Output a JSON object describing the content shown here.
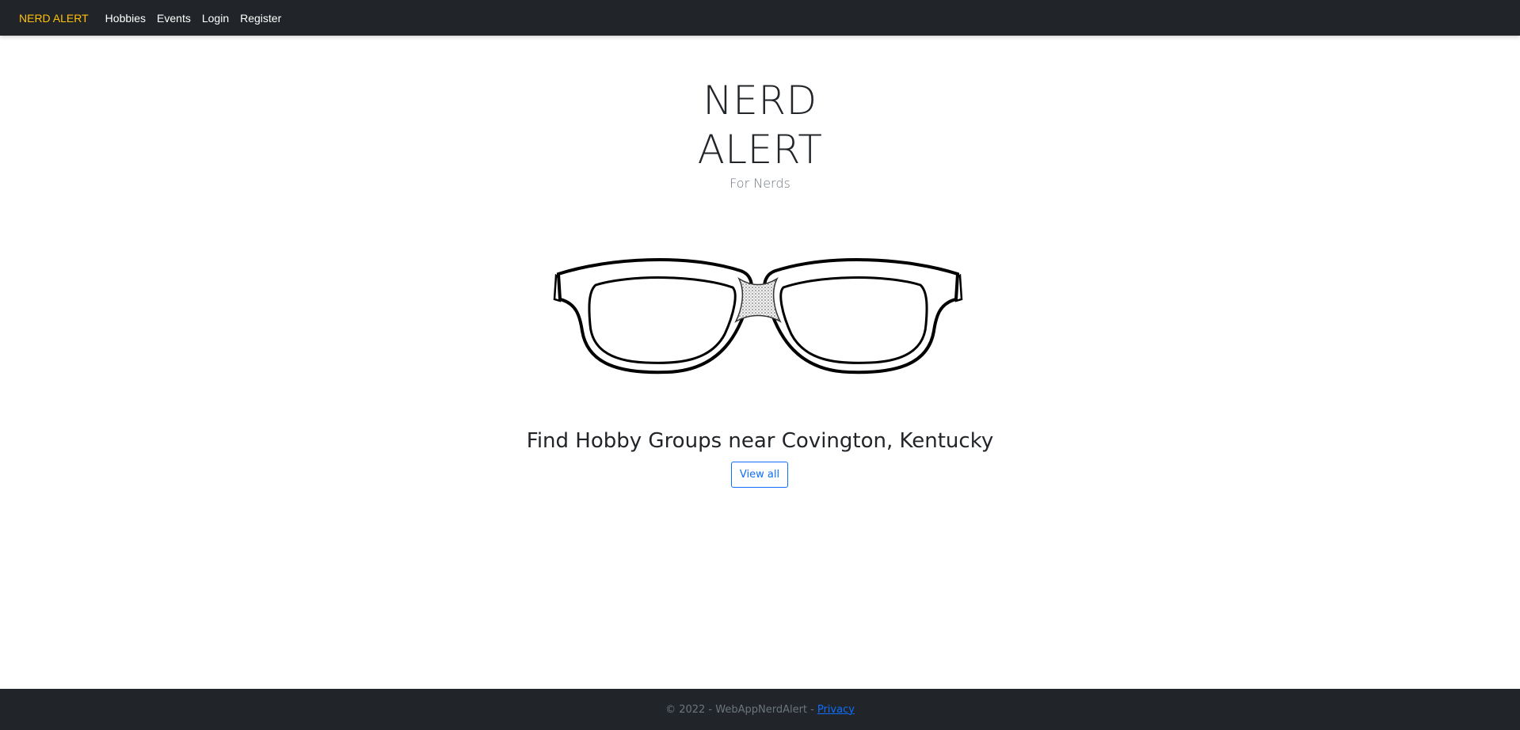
{
  "navbar": {
    "brand": "NERD ALERT",
    "links": [
      "Hobbies",
      "Events",
      "Login",
      "Register"
    ]
  },
  "hero": {
    "title_line1": "NERD",
    "title_line2": "ALERT",
    "subtitle": "For Nerds"
  },
  "image": {
    "icon": "glasses-icon"
  },
  "main": {
    "headline": "Find Hobby Groups near Covington, Kentucky",
    "view_all": "View all"
  },
  "footer": {
    "copyright": "© 2022 - WebAppNerdAlert -",
    "privacy": "Privacy"
  },
  "colors": {
    "nav_bg": "#212529",
    "brand": "#ffc107",
    "link": "#0d6efd",
    "muted": "#6c757d"
  }
}
